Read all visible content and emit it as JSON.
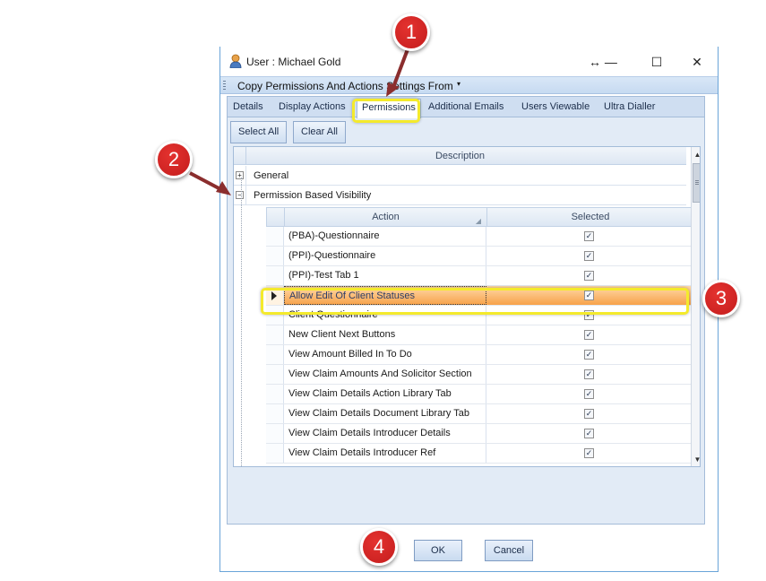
{
  "window": {
    "title": "User : Michael Gold",
    "controls": {
      "restore": "↔ —",
      "maximize": "☐",
      "close": "✕"
    }
  },
  "menu": {
    "text": "Copy Permissions And Actions Settings From",
    "arrow": "▾"
  },
  "tabs": [
    {
      "label": "Details"
    },
    {
      "label": "Display Actions"
    },
    {
      "label": "Permissions",
      "active": true
    },
    {
      "label": "Additional Emails"
    },
    {
      "label": "Users Viewable"
    },
    {
      "label": "Ultra Dialler"
    }
  ],
  "toolbar": {
    "select_all": "Select All",
    "clear_all": "Clear All"
  },
  "grid": {
    "header": "Description",
    "groups": [
      {
        "label": "General",
        "expander": "+"
      },
      {
        "label": "Permission Based Visibility",
        "expander": "−"
      }
    ],
    "detail": {
      "col_action": "Action",
      "col_selected": "Selected",
      "rows": [
        {
          "action": "(PBA)-Questionnaire",
          "selected": "✓"
        },
        {
          "action": "(PPI)-Questionnaire",
          "selected": "✓"
        },
        {
          "action": "(PPI)-Test Tab 1",
          "selected": "✓"
        },
        {
          "action": "Allow Edit Of Client Statuses",
          "selected": "✓"
        },
        {
          "action": "Client Questionnaire",
          "selected": "✓"
        },
        {
          "action": "New Client Next Buttons",
          "selected": "✓"
        },
        {
          "action": "View Amount Billed In To Do",
          "selected": "✓"
        },
        {
          "action": "View Claim Amounts And Solicitor Section",
          "selected": "✓"
        },
        {
          "action": "View Claim Details Action Library Tab",
          "selected": "✓"
        },
        {
          "action": "View Claim Details Document Library Tab",
          "selected": "✓"
        },
        {
          "action": "View Claim Details Introducer Details",
          "selected": "✓"
        },
        {
          "action": "View Claim Details Introducer Ref",
          "selected": "✓"
        }
      ]
    }
  },
  "footer": {
    "ok": "OK",
    "cancel": "Cancel"
  },
  "callouts": [
    "1",
    "2",
    "3",
    "4"
  ],
  "colors": {
    "callout_red": "#d42626",
    "highlight_yellow": "#f4ea2c",
    "selection_orange": "#f7a24b",
    "accent_blue": "#c6daf1"
  }
}
